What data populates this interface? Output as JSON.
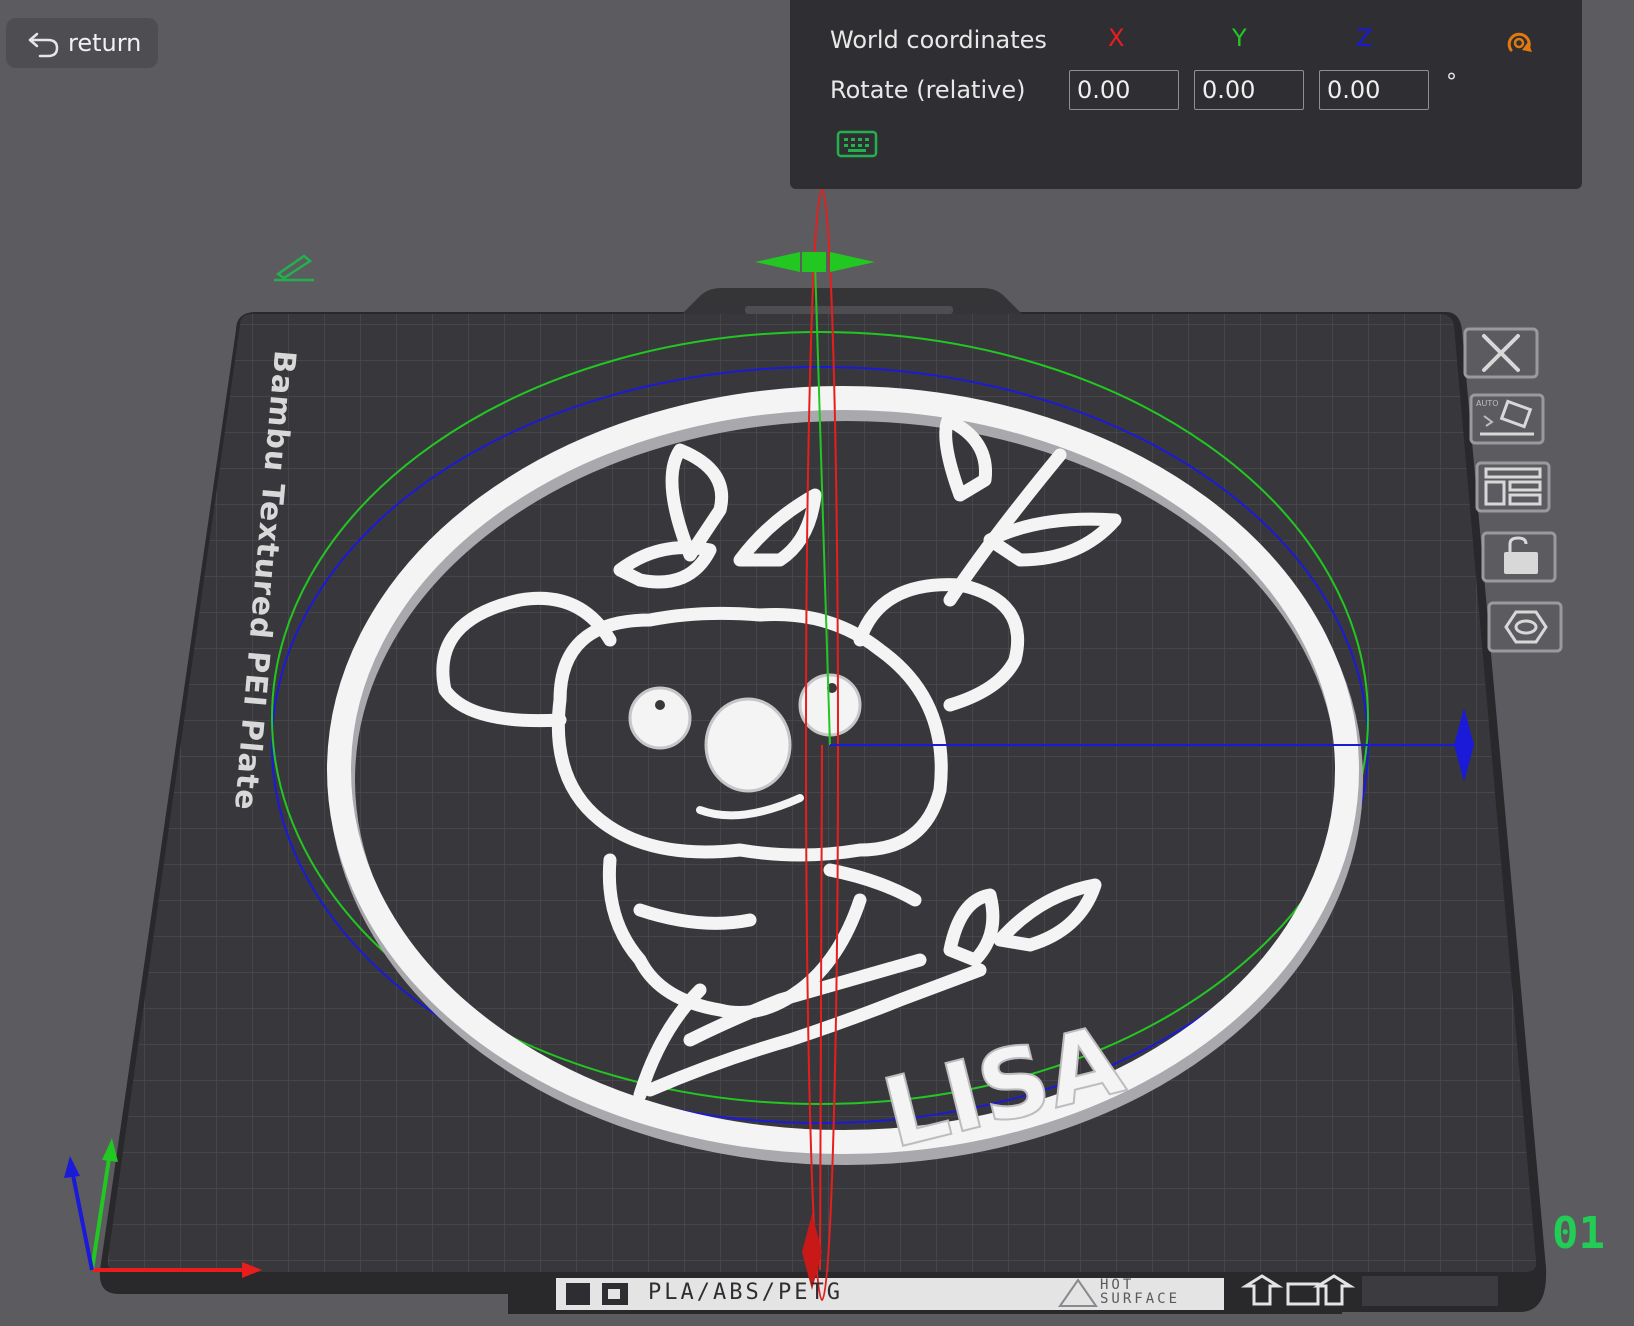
{
  "toolbar": {
    "return_label": "return"
  },
  "gizmo_panel": {
    "coordinate_mode": "World coordinates",
    "axes": {
      "x": "X",
      "y": "Y",
      "z": "Z"
    },
    "rotate_label": "Rotate (relative)",
    "values": {
      "x": "0.00",
      "y": "0.00",
      "z": "0.00"
    },
    "unit": "°"
  },
  "plate": {
    "name": "Bambu Textured PEI Plate",
    "number": "01",
    "material_text": "PLA/ABS/PETG",
    "hot_text_1": "HOT",
    "hot_text_2": "SURFACE"
  },
  "model": {
    "text": "LISA"
  },
  "colors": {
    "x_axis": "#e81e1e",
    "y_axis": "#22c722",
    "z_axis": "#1a1ad8",
    "reset_icon": "#e07a10",
    "plate_number": "#22cc55",
    "model": "#f4f4f4"
  },
  "icons": {
    "return": "undo-arrow-icon",
    "reset": "reset-rotation-icon",
    "keyboard": "keyboard-icon",
    "edit": "pencil-edit-icon",
    "sidebar": [
      "close-icon",
      "auto-orient-icon",
      "arrange-icon",
      "lock-icon",
      "view-hexagon-icon"
    ]
  }
}
